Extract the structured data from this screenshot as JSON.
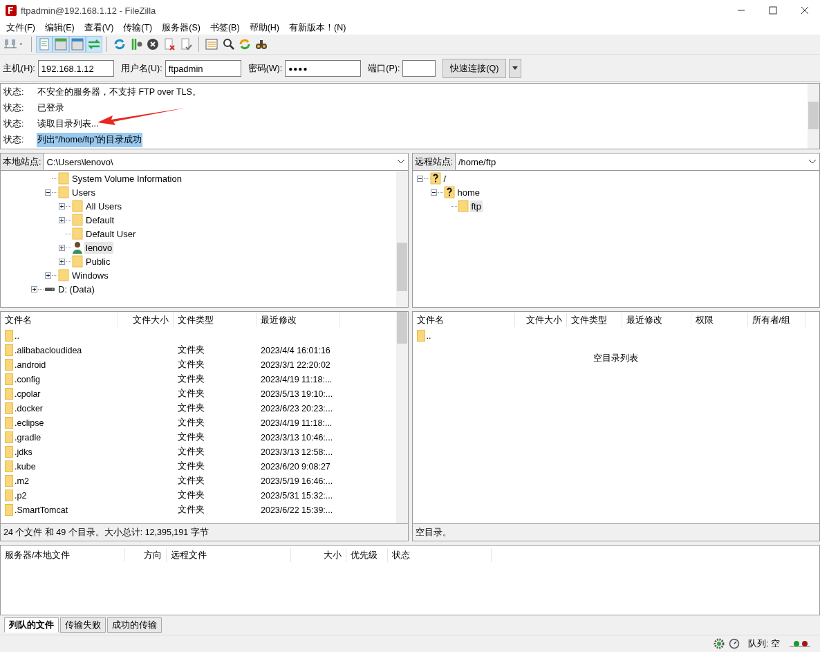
{
  "window": {
    "title": "ftpadmin@192.168.1.12 - FileZilla"
  },
  "menu": [
    "文件(F)",
    "编辑(E)",
    "查看(V)",
    "传输(T)",
    "服务器(S)",
    "书签(B)",
    "帮助(H)",
    "有新版本！(N)"
  ],
  "quickconnect": {
    "host": {
      "label": "主机(H):",
      "value": "192.168.1.12"
    },
    "user": {
      "label": "用户名(U):",
      "value": "ftpadmin"
    },
    "password": {
      "label": "密码(W):",
      "value": "●●●●"
    },
    "port": {
      "label": "端口(P):"
    },
    "button": "快速连接(Q)"
  },
  "log": [
    {
      "label": "状态:",
      "message": "不安全的服务器，不支持 FTP over TLS。",
      "selected": false
    },
    {
      "label": "状态:",
      "message": "已登录",
      "selected": false
    },
    {
      "label": "状态:",
      "message": "读取目录列表...",
      "selected": false
    },
    {
      "label": "状态:",
      "message": "列出“/home/ftp”的目录成功",
      "selected": true
    }
  ],
  "local": {
    "site_label": "本地站点:",
    "path": "C:\\Users\\lenovo\\",
    "tree": [
      {
        "children": [
          {
            "label": "System Volume Information",
            "kind": "folder",
            "selected": false
          },
          {
            "label": "Users",
            "kind": "folder",
            "expanded": true,
            "selected": false,
            "children": [
              {
                "label": "All Users",
                "kind": "folder",
                "expanded": false,
                "selected": false
              },
              {
                "label": "Default",
                "kind": "folder",
                "expanded": false,
                "selected": false
              },
              {
                "label": "Default User",
                "kind": "folder",
                "selected": false
              },
              {
                "label": "lenovo",
                "kind": "user",
                "expanded": false,
                "selected": true
              },
              {
                "label": "Public",
                "kind": "folder",
                "expanded": false,
                "selected": false
              }
            ]
          },
          {
            "label": "Windows",
            "kind": "folder",
            "expanded": false,
            "selected": false
          }
        ]
      },
      {
        "label": "D: (Data)",
        "kind": "drive",
        "expanded": false,
        "selected": false
      }
    ],
    "columns": [
      "文件名",
      "文件大小",
      "文件类型",
      "最近修改"
    ],
    "files": [
      {
        "name": ".."
      },
      {
        "name": ".alibabacloudidea",
        "type": "文件夹",
        "modified": "2023/4/4 16:01:16"
      },
      {
        "name": ".android",
        "type": "文件夹",
        "modified": "2023/3/1 22:20:02"
      },
      {
        "name": ".config",
        "type": "文件夹",
        "modified": "2023/4/19 11:18:..."
      },
      {
        "name": ".cpolar",
        "type": "文件夹",
        "modified": "2023/5/13 19:10:..."
      },
      {
        "name": ".docker",
        "type": "文件夹",
        "modified": "2023/6/23 20:23:..."
      },
      {
        "name": ".eclipse",
        "type": "文件夹",
        "modified": "2023/4/19 11:18:..."
      },
      {
        "name": ".gradle",
        "type": "文件夹",
        "modified": "2023/3/13 10:46:..."
      },
      {
        "name": ".jdks",
        "type": "文件夹",
        "modified": "2023/3/13 12:58:..."
      },
      {
        "name": ".kube",
        "type": "文件夹",
        "modified": "2023/6/20 9:08:27"
      },
      {
        "name": ".m2",
        "type": "文件夹",
        "modified": "2023/5/19 16:46:..."
      },
      {
        "name": ".p2",
        "type": "文件夹",
        "modified": "2023/5/31 15:32:..."
      },
      {
        "name": ".SmartTomcat",
        "type": "文件夹",
        "modified": "2023/6/22 15:39:..."
      }
    ],
    "status": "24 个文件 和 49 个目录。大小总计: 12,395,191 字节"
  },
  "remote": {
    "site_label": "远程站点:",
    "path": "/home/ftp",
    "tree": [
      {
        "label": "/",
        "kind": "unknown",
        "expanded": true,
        "selected": false,
        "children": [
          {
            "label": "home",
            "kind": "unknown",
            "expanded": true,
            "selected": false,
            "children": [
              {
                "label": "ftp",
                "kind": "folder",
                "selected": true
              }
            ]
          }
        ]
      }
    ],
    "columns": [
      "文件名",
      "文件大小",
      "文件类型",
      "最近修改",
      "权限",
      "所有者/组"
    ],
    "files": [
      {
        "name": ".."
      }
    ],
    "empty_message": "空目录列表",
    "status": "空目录。"
  },
  "queue": {
    "columns": [
      "服务器/本地文件",
      "方向",
      "远程文件",
      "大小",
      "优先级",
      "状态"
    ],
    "tabs": [
      {
        "label": "列队的文件",
        "selected": true
      },
      {
        "label": "传输失败",
        "selected": false
      },
      {
        "label": "成功的传输",
        "selected": false
      }
    ],
    "status": "队列: 空"
  }
}
